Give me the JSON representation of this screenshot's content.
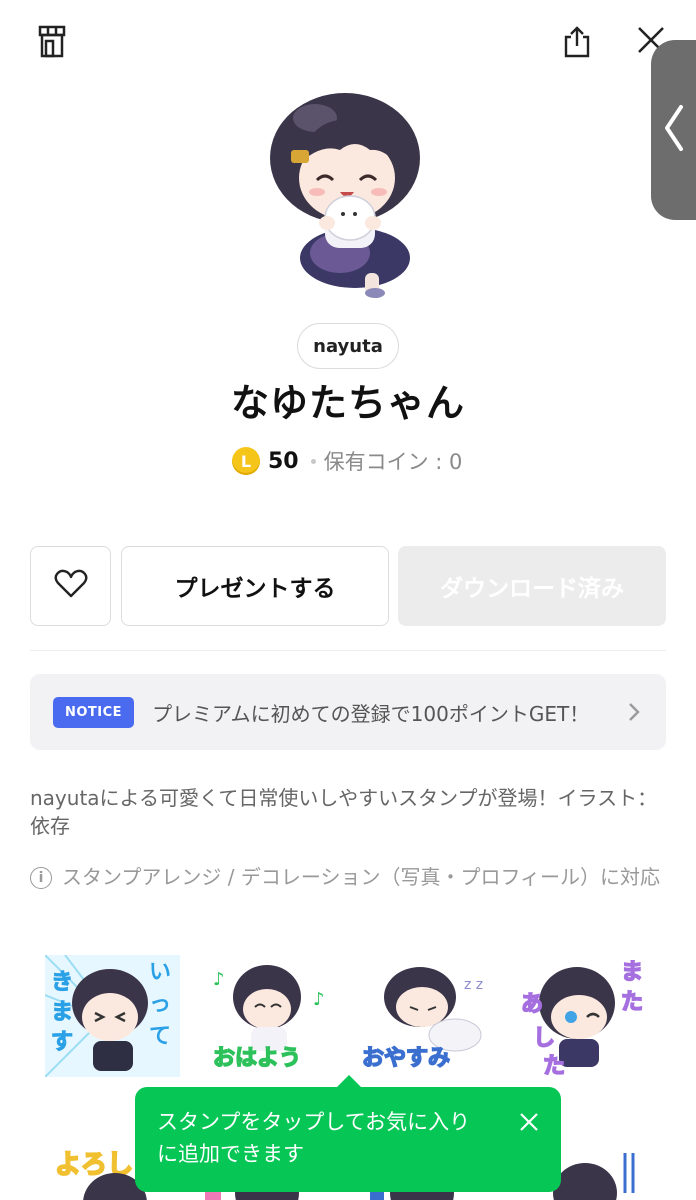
{
  "header": {
    "shop_icon": "store-icon",
    "share_icon": "share-icon",
    "close_icon": "close-icon"
  },
  "side_handle": {
    "icon": "chevron-left-icon"
  },
  "product": {
    "author": "nayuta",
    "title": "なゆたちゃん",
    "coin_symbol": "L",
    "price": "50",
    "owned_coins": "保有コイン : 0"
  },
  "actions": {
    "like_icon": "heart-icon",
    "gift_label": "プレゼントする",
    "download_label": "ダウンロード済み"
  },
  "notice": {
    "badge": "NOTICE",
    "text": "プレミアムに初めての登録で100ポイントGET！"
  },
  "description": "nayutaによる可愛くて日常使いしやすいスタンプが登場！イラスト：依存",
  "info": "スタンプアレンジ / デコレーション（写真・プロフィール）に対応",
  "stickers": [
    {
      "text": "いって\nきます"
    },
    {
      "text": "おはよう"
    },
    {
      "text": "おやすみ"
    },
    {
      "text": "また\nあした"
    }
  ],
  "toast": {
    "text": "スタンプをタップしてお気に入りに追加できます"
  },
  "colors": {
    "line_green": "#06c755",
    "notice_blue": "#4a6bf0",
    "coin_gold": "#f6c51a"
  }
}
